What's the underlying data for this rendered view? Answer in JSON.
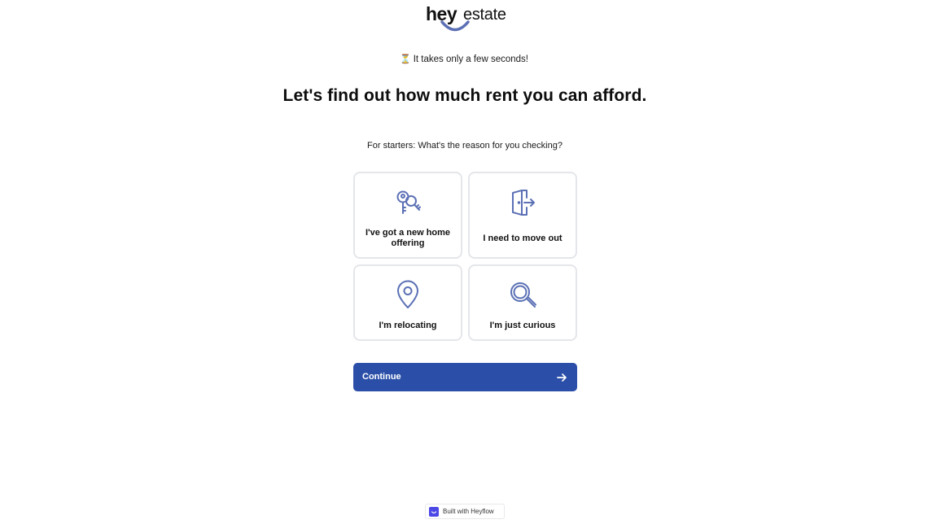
{
  "brand": {
    "logo_hey": "hey",
    "logo_estate": "estate",
    "accent_color": "#5b70b5"
  },
  "intro": {
    "hourglass_icon": "hourglass-icon",
    "hourglass_glyph": "⏳",
    "subtitle": "It takes only a few seconds!",
    "headline": "Let's find out how much rent you can afford.",
    "question": "For starters: What's the reason for you checking?"
  },
  "options": [
    {
      "label": "I've got a new home offering",
      "icon": "keys-icon"
    },
    {
      "label": "I need to move out",
      "icon": "door-exit-icon"
    },
    {
      "label": "I'm relocating",
      "icon": "location-pin-icon"
    },
    {
      "label": "I'm just curious",
      "icon": "magnifier-icon"
    }
  ],
  "continue_button": {
    "label": "Continue",
    "icon": "arrow-right-icon",
    "color": "#2b4fa8"
  },
  "footer": {
    "badge_text": "Built with Heyflow",
    "badge_icon": "heyflow-logo-icon",
    "badge_color": "#4c48e6"
  }
}
